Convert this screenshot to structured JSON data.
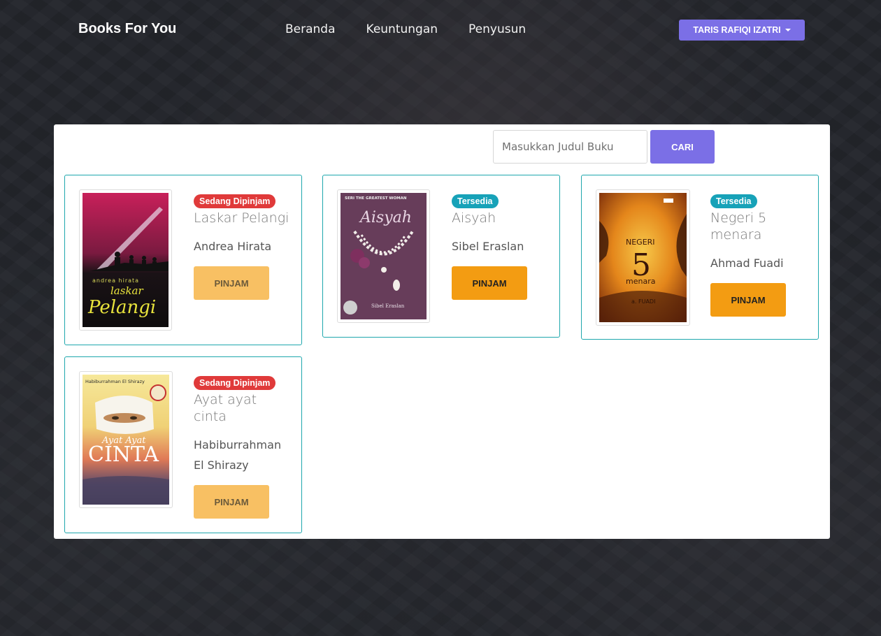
{
  "brand": "Books For You",
  "nav": {
    "items": [
      "Beranda",
      "Keuntungan",
      "Penyusun"
    ],
    "user_label": "TARIS RAFIQI IZATRI"
  },
  "search": {
    "placeholder": "Masukkan Judul Buku",
    "value": "",
    "button_label": "CARI"
  },
  "books": [
    {
      "status": "Sedang Dipinjam",
      "status_type": "borrowed",
      "title": "Laskar Pelangi",
      "author": "Andrea Hirata",
      "button_label": "PINJAM",
      "button_enabled": false,
      "cover": {
        "top_text": "andrea hirata",
        "main_text_1": "laskar",
        "main_text_2": "Pelangi"
      }
    },
    {
      "status": "Tersedia",
      "status_type": "available",
      "title": "Aisyah",
      "author": "Sibel Eraslan",
      "button_label": "PINJAM",
      "button_enabled": true,
      "cover": {
        "top_text": "SERI THE GREATEST WOMAN",
        "main_text_1": "Aisyah",
        "main_text_2": "Sibel Eraslan"
      }
    },
    {
      "status": "Tersedia",
      "status_type": "available",
      "title": "Negeri 5 menara",
      "author": "Ahmad Fuadi",
      "button_label": "PINJAM",
      "button_enabled": true,
      "cover": {
        "top_text": "NEGERI",
        "main_text_1": "5",
        "main_text_2": "menara",
        "bottom_text": "a. FUADI"
      }
    },
    {
      "status": "Sedang Dipinjam",
      "status_type": "borrowed",
      "title": "Ayat ayat cinta",
      "author": "Habiburrahman El Shirazy",
      "button_label": "PINJAM",
      "button_enabled": false,
      "cover": {
        "top_text": "Habiburrahman El Shirazy",
        "main_text_1": "Ayat Ayat",
        "main_text_2": "CINTA"
      }
    }
  ],
  "colors": {
    "accent": "#7b6fe6",
    "card_border": "#1ea7ad",
    "badge_borrowed": "#e03a3a",
    "badge_available": "#17a2b8",
    "pinjam_enabled": "#f39c12",
    "pinjam_disabled": "#f8c063"
  }
}
